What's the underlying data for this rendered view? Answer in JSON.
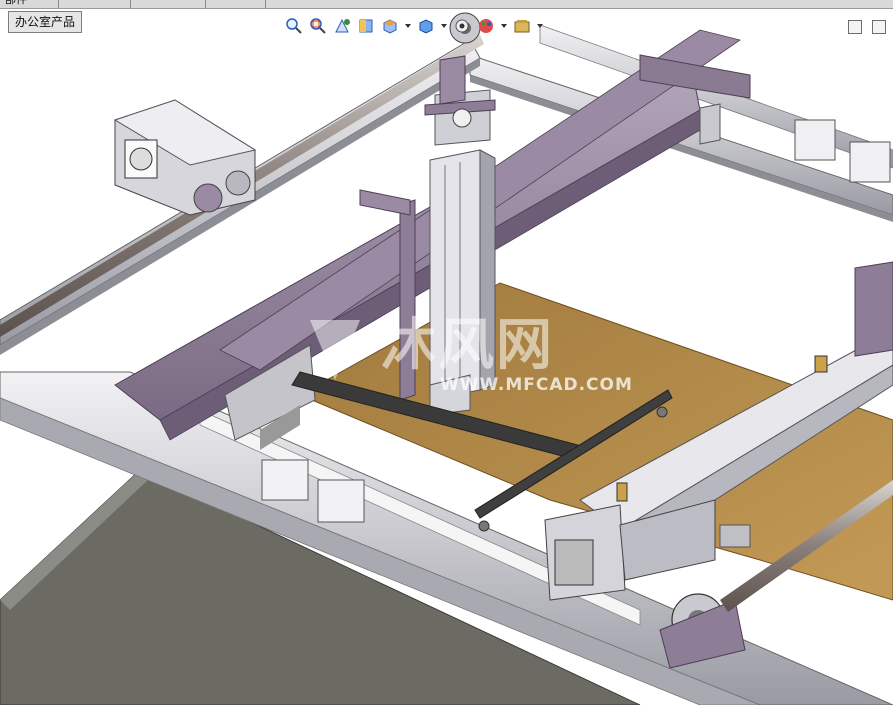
{
  "window": {
    "menu_tab_label": "部件",
    "document_tab_label": "办公室产品"
  },
  "toolbar": {
    "icons": [
      "zoom-to-fit-icon",
      "zoom-to-area-icon",
      "previous-view-icon",
      "section-view-icon",
      "view-orientation-icon",
      "display-style-icon",
      "hide-show-items-icon",
      "edit-appearance-icon",
      "apply-scene-icon",
      "view-settings-icon"
    ]
  },
  "watermark": {
    "brand_text": "沐风网",
    "url_text": "WWW.MFCAD.COM"
  },
  "colors": {
    "background": "#ffffff",
    "frame_purple": "#8e7d96",
    "rail_gray": "#c9c9cf",
    "board_tan": "#b38a4a",
    "table_gray": "#6a6a64"
  }
}
